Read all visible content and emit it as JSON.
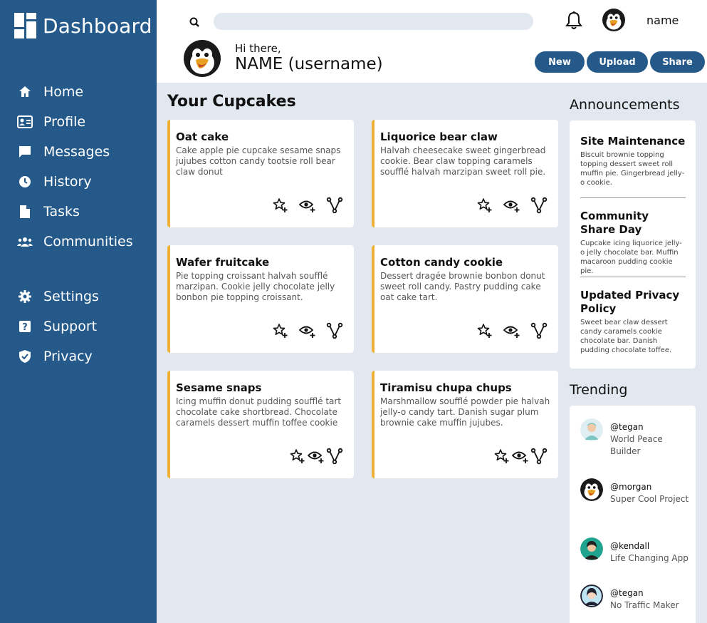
{
  "brand": {
    "title": "Dashboard"
  },
  "nav": {
    "primary": [
      {
        "label": "Home",
        "icon": "home-icon"
      },
      {
        "label": "Profile",
        "icon": "id-card-icon"
      },
      {
        "label": "Messages",
        "icon": "message-icon"
      },
      {
        "label": "History",
        "icon": "clock-icon"
      },
      {
        "label": "Tasks",
        "icon": "file-icon"
      },
      {
        "label": "Communities",
        "icon": "users-icon"
      }
    ],
    "secondary": [
      {
        "label": "Settings",
        "icon": "gear-icon"
      },
      {
        "label": "Support",
        "icon": "help-icon"
      },
      {
        "label": "Privacy",
        "icon": "shield-icon"
      }
    ]
  },
  "header": {
    "search_placeholder": "",
    "user_name": "name",
    "greeting": "Hi there,",
    "full_name": "NAME (username)",
    "buttons": {
      "new": "New",
      "upload": "Upload",
      "share": "Share"
    }
  },
  "main": {
    "title": "Your Cupcakes",
    "cards": [
      {
        "title": "Oat cake",
        "desc": "Cake apple pie cupcake sesame snaps jujubes cotton candy tootsie roll bear claw donut"
      },
      {
        "title": "Liquorice bear claw",
        "desc": "Halvah cheesecake sweet gingerbread cookie. Bear claw topping caramels soufflé halvah marzipan sweet roll pie."
      },
      {
        "title": "Wafer fruitcake",
        "desc": "Pie topping croissant halvah soufflé marzipan. Cookie jelly chocolate jelly bonbon pie topping croissant."
      },
      {
        "title": "Cotton candy cookie",
        "desc": "Dessert dragée brownie bonbon donut sweet roll candy. Pastry pudding cake oat cake tart."
      },
      {
        "title": "Sesame snaps",
        "desc": "Icing muffin donut pudding soufflé tart chocolate cake shortbread. Chocolate caramels dessert muffin toffee cookie"
      },
      {
        "title": "Tiramisu chupa chups",
        "desc": "Marshmallow soufflé powder pie halvah jelly-o candy tart. Danish sugar plum brownie cake muffin jujubes."
      }
    ]
  },
  "announcements": {
    "title": "Announcements",
    "items": [
      {
        "title": "Site Maintenance",
        "body": "Biscuit brownie topping topping dessert sweet roll muffin pie. Gingerbread jelly-o cookie."
      },
      {
        "title": "Community Share Day",
        "body": "Cupcake icing liquorice jelly-o jelly chocolate bar. Muffin macaroon pudding cookie pie."
      },
      {
        "title": "Updated Privacy Policy",
        "body": "Sweet bear claw dessert candy caramels cookie chocolate bar. Danish pudding chocolate toffee."
      }
    ]
  },
  "trending": {
    "title": "Trending",
    "items": [
      {
        "handle": "@tegan",
        "project": "World Peace Builder"
      },
      {
        "handle": "@morgan",
        "project": "Super Cool Project"
      },
      {
        "handle": "@kendall",
        "project": "Life Changing App"
      },
      {
        "handle": "@tegan",
        "project": "No Traffic Maker"
      }
    ]
  },
  "colors": {
    "sidebar": "#24598a",
    "accent": "#efb035",
    "background": "#e2e8f0"
  }
}
